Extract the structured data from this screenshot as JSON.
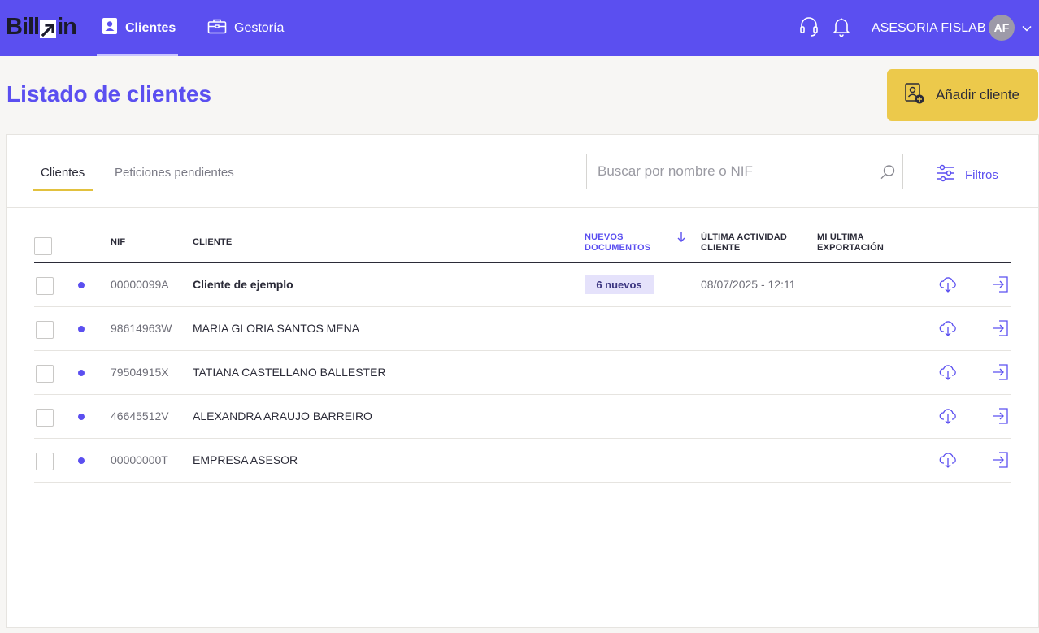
{
  "brand": {
    "logo_text_left": "Bill",
    "logo_text_right": "in"
  },
  "nav": {
    "items": [
      {
        "label": "Clientes",
        "active": true
      },
      {
        "label": "Gestoría",
        "active": false
      }
    ],
    "account_name": "ASESORIA FISLAB",
    "avatar_initials": "AF"
  },
  "header": {
    "title": "Listado de clientes",
    "add_button_label": "Añadir cliente"
  },
  "tabs": [
    {
      "label": "Clientes",
      "active": true
    },
    {
      "label": "Peticiones pendientes",
      "active": false
    }
  ],
  "search": {
    "placeholder": "Buscar por nombre o NIF",
    "value": ""
  },
  "filters_label": "Filtros",
  "table": {
    "columns": {
      "nif": "NIF",
      "cliente": "CLIENTE",
      "nuevos_line1": "NUEVOS",
      "nuevos_line2": "DOCUMENTOS",
      "ultima_line1": "ÚLTIMA ACTIVIDAD",
      "ultima_line2": "CLIENTE",
      "export_line1": "MI ÚLTIMA",
      "export_line2": "EXPORTACIÓN"
    },
    "rows": [
      {
        "nif": "00000099A",
        "cliente": "Cliente de ejemplo",
        "nuevos": "6 nuevos",
        "ultima_actividad": "08/07/2025 - 12:11"
      },
      {
        "nif": "98614963W",
        "cliente": "MARIA GLORIA SANTOS MENA",
        "nuevos": "",
        "ultima_actividad": ""
      },
      {
        "nif": "79504915X",
        "cliente": "TATIANA CASTELLANO BALLESTER",
        "nuevos": "",
        "ultima_actividad": ""
      },
      {
        "nif": "46645512V",
        "cliente": "ALEXANDRA ARAUJO BARREIRO",
        "nuevos": "",
        "ultima_actividad": ""
      },
      {
        "nif": "00000000T",
        "cliente": "EMPRESA ASESOR",
        "nuevos": "",
        "ultima_actividad": ""
      }
    ]
  },
  "colors": {
    "primary": "#5b4ff0",
    "accent_yellow": "#ecc94b",
    "badge_bg": "#e5e2fb"
  }
}
